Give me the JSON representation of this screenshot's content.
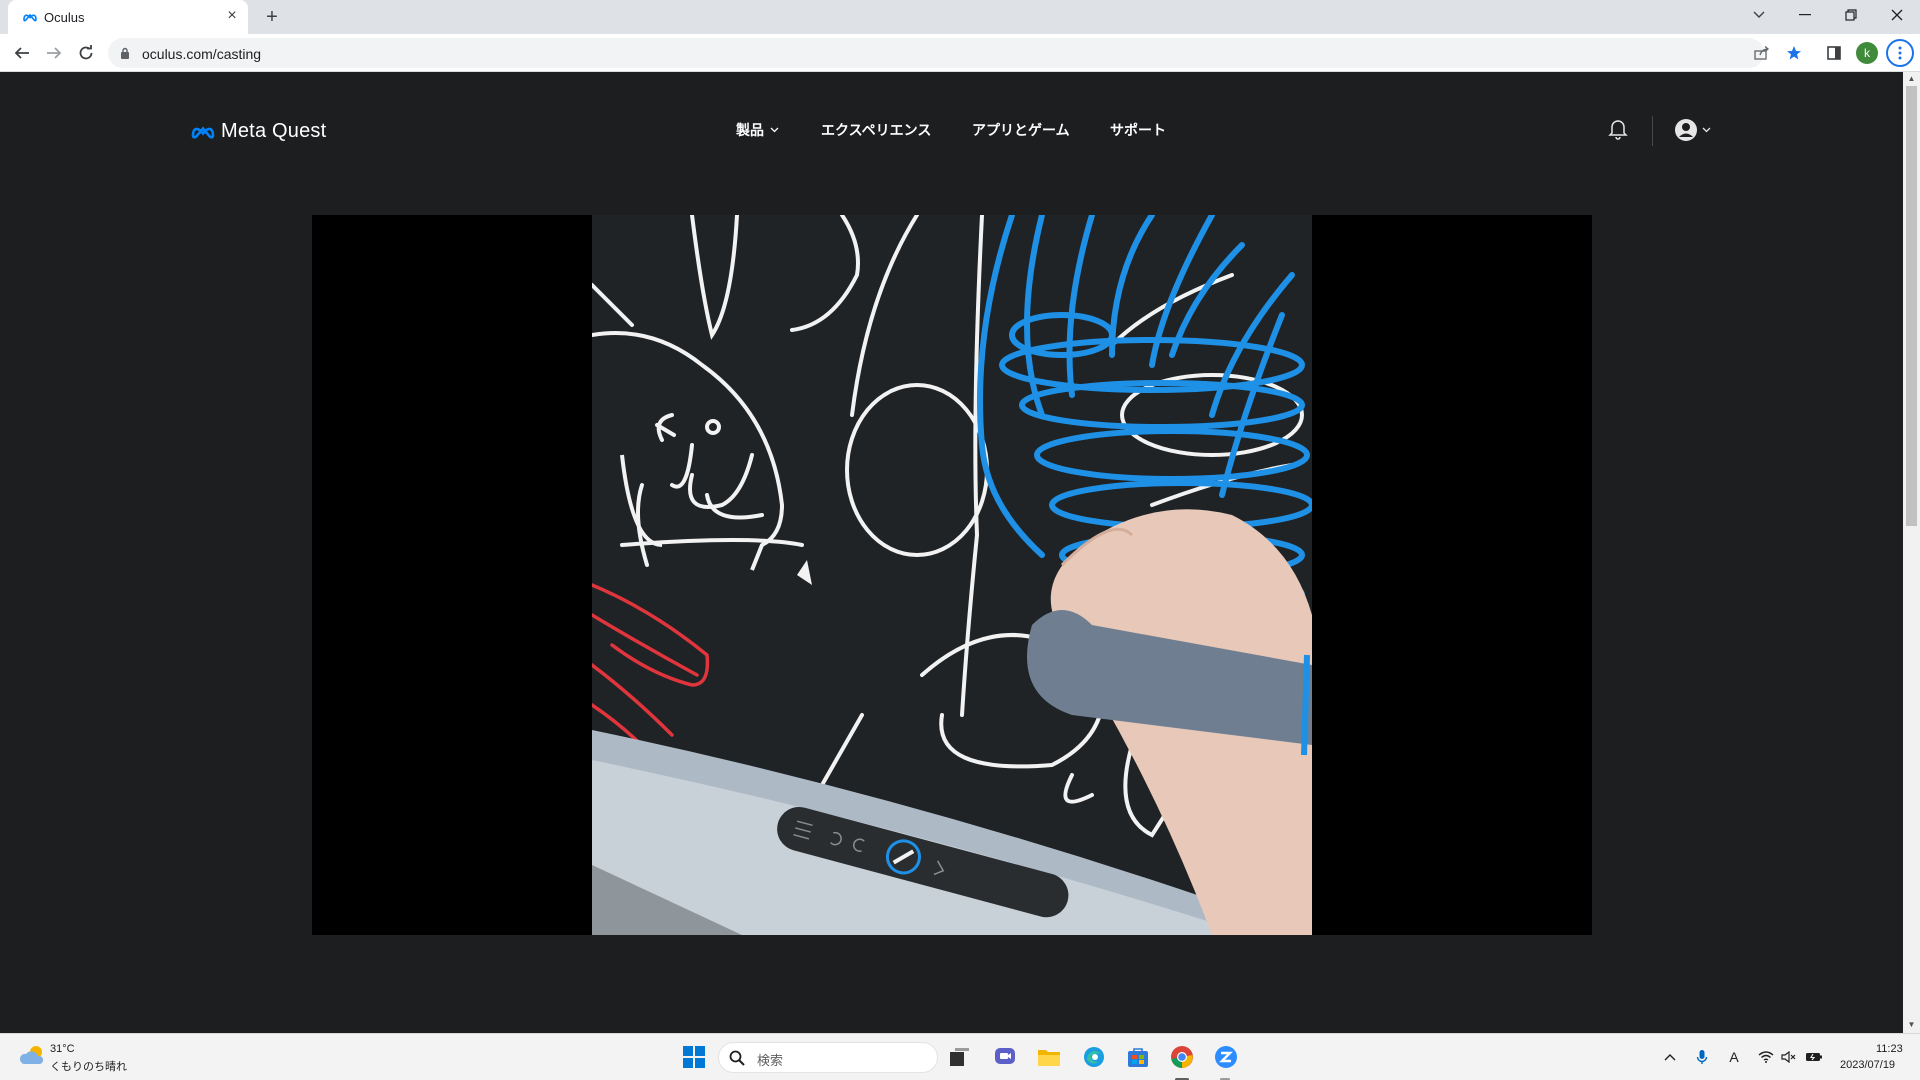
{
  "browser": {
    "tab_title": "Oculus",
    "tab_close": "×",
    "new_tab": "+",
    "url": "oculus.com/casting",
    "profile_initial": "k"
  },
  "site": {
    "brand": "Meta Quest",
    "nav": [
      {
        "label": "製品",
        "has_dropdown": true
      },
      {
        "label": "エクスペリエンス"
      },
      {
        "label": "アプリとゲーム"
      },
      {
        "label": "サポート"
      }
    ]
  },
  "taskbar": {
    "weather_temp": "31°C",
    "weather_desc": "くもりのち晴れ",
    "search_placeholder": "検索",
    "ime_indicator": "A",
    "time": "11:23",
    "date": "2023/07/19"
  },
  "colors": {
    "accent_blue": "#1a73e8",
    "page_background": "#1c1e20",
    "meta_logo_blue": "#0082fb",
    "drawing_blue": "#1e90e6",
    "drawing_red": "#e0353c"
  }
}
